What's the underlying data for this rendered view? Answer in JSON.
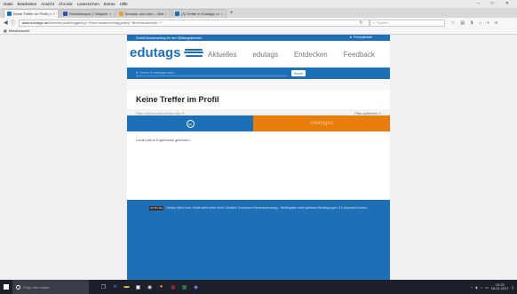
{
  "browser": {
    "menu": [
      "Datei",
      "Bearbeiten",
      "Ansicht",
      "Chronik",
      "Lesezeichen",
      "Extras",
      "Hilfe"
    ],
    "window_controls": [
      "–",
      "□",
      "✕"
    ],
    "tabs": [
      {
        "label": "Keine Treffer im Profil | ed...",
        "color": "#1d70b8",
        "active": true
      },
      {
        "label": "Redaktionpad | Tätigkeitsb...",
        "color": "#3355aa",
        "active": false
      },
      {
        "label": "Browser und Adm – WebM...",
        "color": "#e8a33c",
        "active": false
      },
      {
        "label": "(3) Treffer in Edutags | edu...",
        "color": "#1d70b8",
        "active": false
      }
    ],
    "tab_close": "×",
    "new_tab": "+",
    "url": {
      "domain": "www.edutags.de",
      "path": "/bewerte/profil/taggedby/~Birnenkolacheb/taggedby/~Birnenkolacheb/~?"
    },
    "search_placeholder": "Suchen",
    "bookmarks_label": "Meistbesucht"
  },
  "site": {
    "topstrip_text": "Social Bookmarking für den Bildungsbereich",
    "login_label": "Freundeliste",
    "logo_text": "edutags",
    "nav": [
      "Aktuelles",
      "edutags",
      "Entdecken",
      "Feedback"
    ],
    "search_placeholder": "Suche in edutags nach...",
    "search_button": "Suche",
    "profile_title": "Keine Treffer im Profil",
    "filter_label": "Filter: Meine Lesezeichen  Alle",
    "filter_remove": "Filter aufheben",
    "tab_cc": "cc",
    "tab_meine": "meinsges",
    "no_result": "Leider keine Ergebnisse gefunden.",
    "footer": {
      "globe_lines": [
        "GLOBE",
        "EDUCATION"
      ],
      "dbs_small": "deutscher",
      "dbs_big": "bildungs",
      "dbs_small2": "server",
      "dui_line1": "UNIVERSITÄT",
      "dui_line2": "DUISBURG",
      "dui_line3": "ESSEN",
      "links": "Impressum  |  Datenschutz  |  AGB",
      "desc": "Edutags ist ein Kooperationsprojekt von Deutscher Bildungsserver und Universität Duisburg-Essen/Learning Lab",
      "license": "Dieses Werk bzw. Inhalt steht unter einer Creative Commons Namensnennung - Weitergabe unter gleichen Bedingungen 3.0 Unported Lizenz.",
      "cc_badge": "CC BY-SA"
    }
  },
  "taskbar": {
    "search_placeholder": "Frag mich etwas",
    "time": "10:23",
    "date": "15.01.2017"
  }
}
